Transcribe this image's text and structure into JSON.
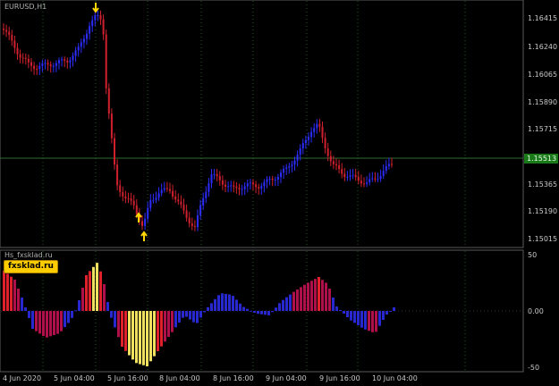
{
  "main_pane": {
    "symbol_label": "EURUSD,H1",
    "current_price": "1.15513",
    "price_ticks": [
      "1.16415",
      "1.16240",
      "1.16065",
      "1.15890",
      "1.15715",
      "1.15540",
      "1.15365",
      "1.15190",
      "1.15015"
    ]
  },
  "indicator_pane": {
    "indicator_label": "Hs_fxsklad.ru",
    "brand_badge": "fxsklad.ru",
    "value_ticks": [
      "50",
      "0.00",
      "-50"
    ]
  },
  "time_axis": {
    "labels": [
      "4 Jun 2020",
      "5 Jun 04:00",
      "5 Jun 16:00",
      "8 Jun 04:00",
      "8 Jun 16:00",
      "9 Jun 04:00",
      "9 Jun 16:00",
      "10 Jun 04:00"
    ]
  },
  "colors": {
    "bull_candle": "#2c2cff",
    "bear_candle": "#d0202e",
    "arrow": "#ffd700",
    "grid": "#1f5a1f",
    "price_line": "#2e6a2e",
    "price_badge": "#1a7a1a"
  }
}
